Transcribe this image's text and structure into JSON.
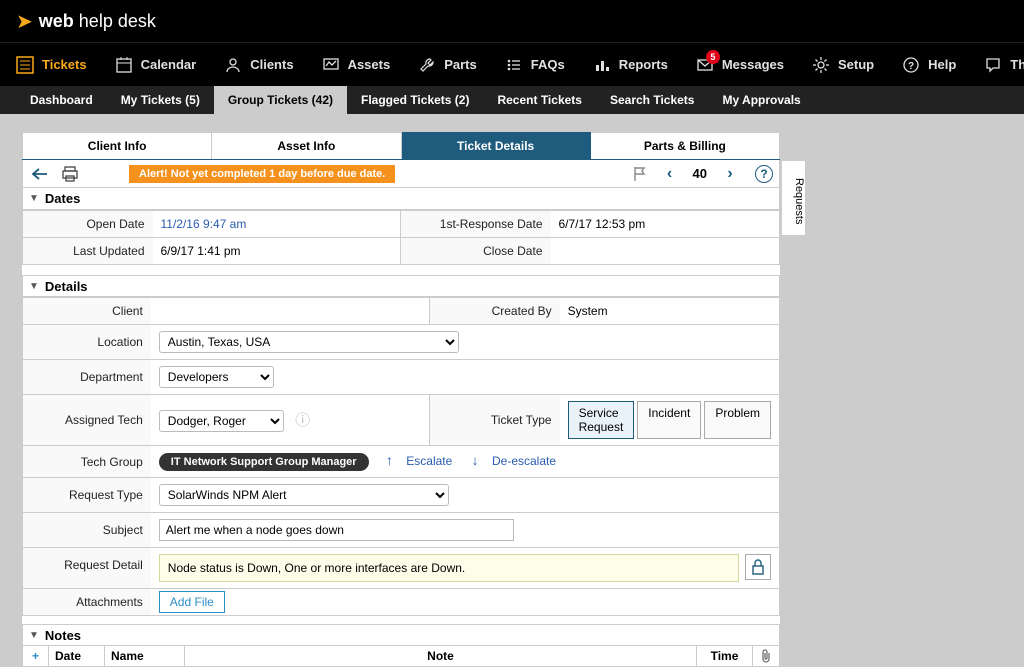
{
  "brand": {
    "name_a": "web",
    "name_b": "help desk"
  },
  "mainnav": {
    "tickets": "Tickets",
    "calendar": "Calendar",
    "clients": "Clients",
    "assets": "Assets",
    "parts": "Parts",
    "faqs": "FAQs",
    "reports": "Reports",
    "messages": "Messages",
    "messages_badge": "5",
    "setup": "Setup",
    "help": "Help",
    "thwack": "Thwack"
  },
  "subnav": {
    "dashboard": "Dashboard",
    "my_tickets": "My Tickets (5)",
    "group_tickets": "Group Tickets (42)",
    "flagged": "Flagged Tickets (2)",
    "recent": "Recent Tickets",
    "search": "Search Tickets",
    "approvals": "My Approvals"
  },
  "detail_tabs": {
    "client": "Client Info",
    "asset": "Asset Info",
    "ticket": "Ticket Details",
    "parts": "Parts & Billing"
  },
  "toolbar": {
    "alert": "Alert! Not yet completed 1 day before due date.",
    "page_num": "40"
  },
  "side_tab": "Requests",
  "sections": {
    "dates": "Dates",
    "details": "Details",
    "notes": "Notes"
  },
  "dates": {
    "open_lbl": "Open Date",
    "open_val": "11/2/16 9:47 am",
    "resp_lbl": "1st-Response Date",
    "resp_val": "6/7/17 12:53 pm",
    "upd_lbl": "Last Updated",
    "upd_val": "6/9/17 1:41 pm",
    "close_lbl": "Close Date",
    "close_val": ""
  },
  "details": {
    "client_lbl": "Client",
    "createdby_lbl": "Created By",
    "createdby_val": "System",
    "location_lbl": "Location",
    "location_val": "Austin, Texas, USA",
    "dept_lbl": "Department",
    "dept_val": "Developers",
    "tech_lbl": "Assigned Tech",
    "tech_val": "Dodger, Roger",
    "tt_lbl": "Ticket Type",
    "tt_opts": {
      "a": "Service Request",
      "b": "Incident",
      "c": "Problem"
    },
    "group_lbl": "Tech Group",
    "group_pill": "IT Network Support  Group Manager",
    "escalate": "Escalate",
    "deescalate": "De-escalate",
    "reqtype_lbl": "Request Type",
    "reqtype_val": "SolarWinds NPM Alert",
    "subject_lbl": "Subject",
    "subject_val": "Alert me when a node goes down",
    "detail_lbl": "Request Detail",
    "detail_val": "Node status is Down, One or more interfaces are Down.",
    "attach_lbl": "Attachments",
    "addfile": "Add File"
  },
  "notes_cols": {
    "date": "Date",
    "name": "Name",
    "note": "Note",
    "time": "Time"
  }
}
